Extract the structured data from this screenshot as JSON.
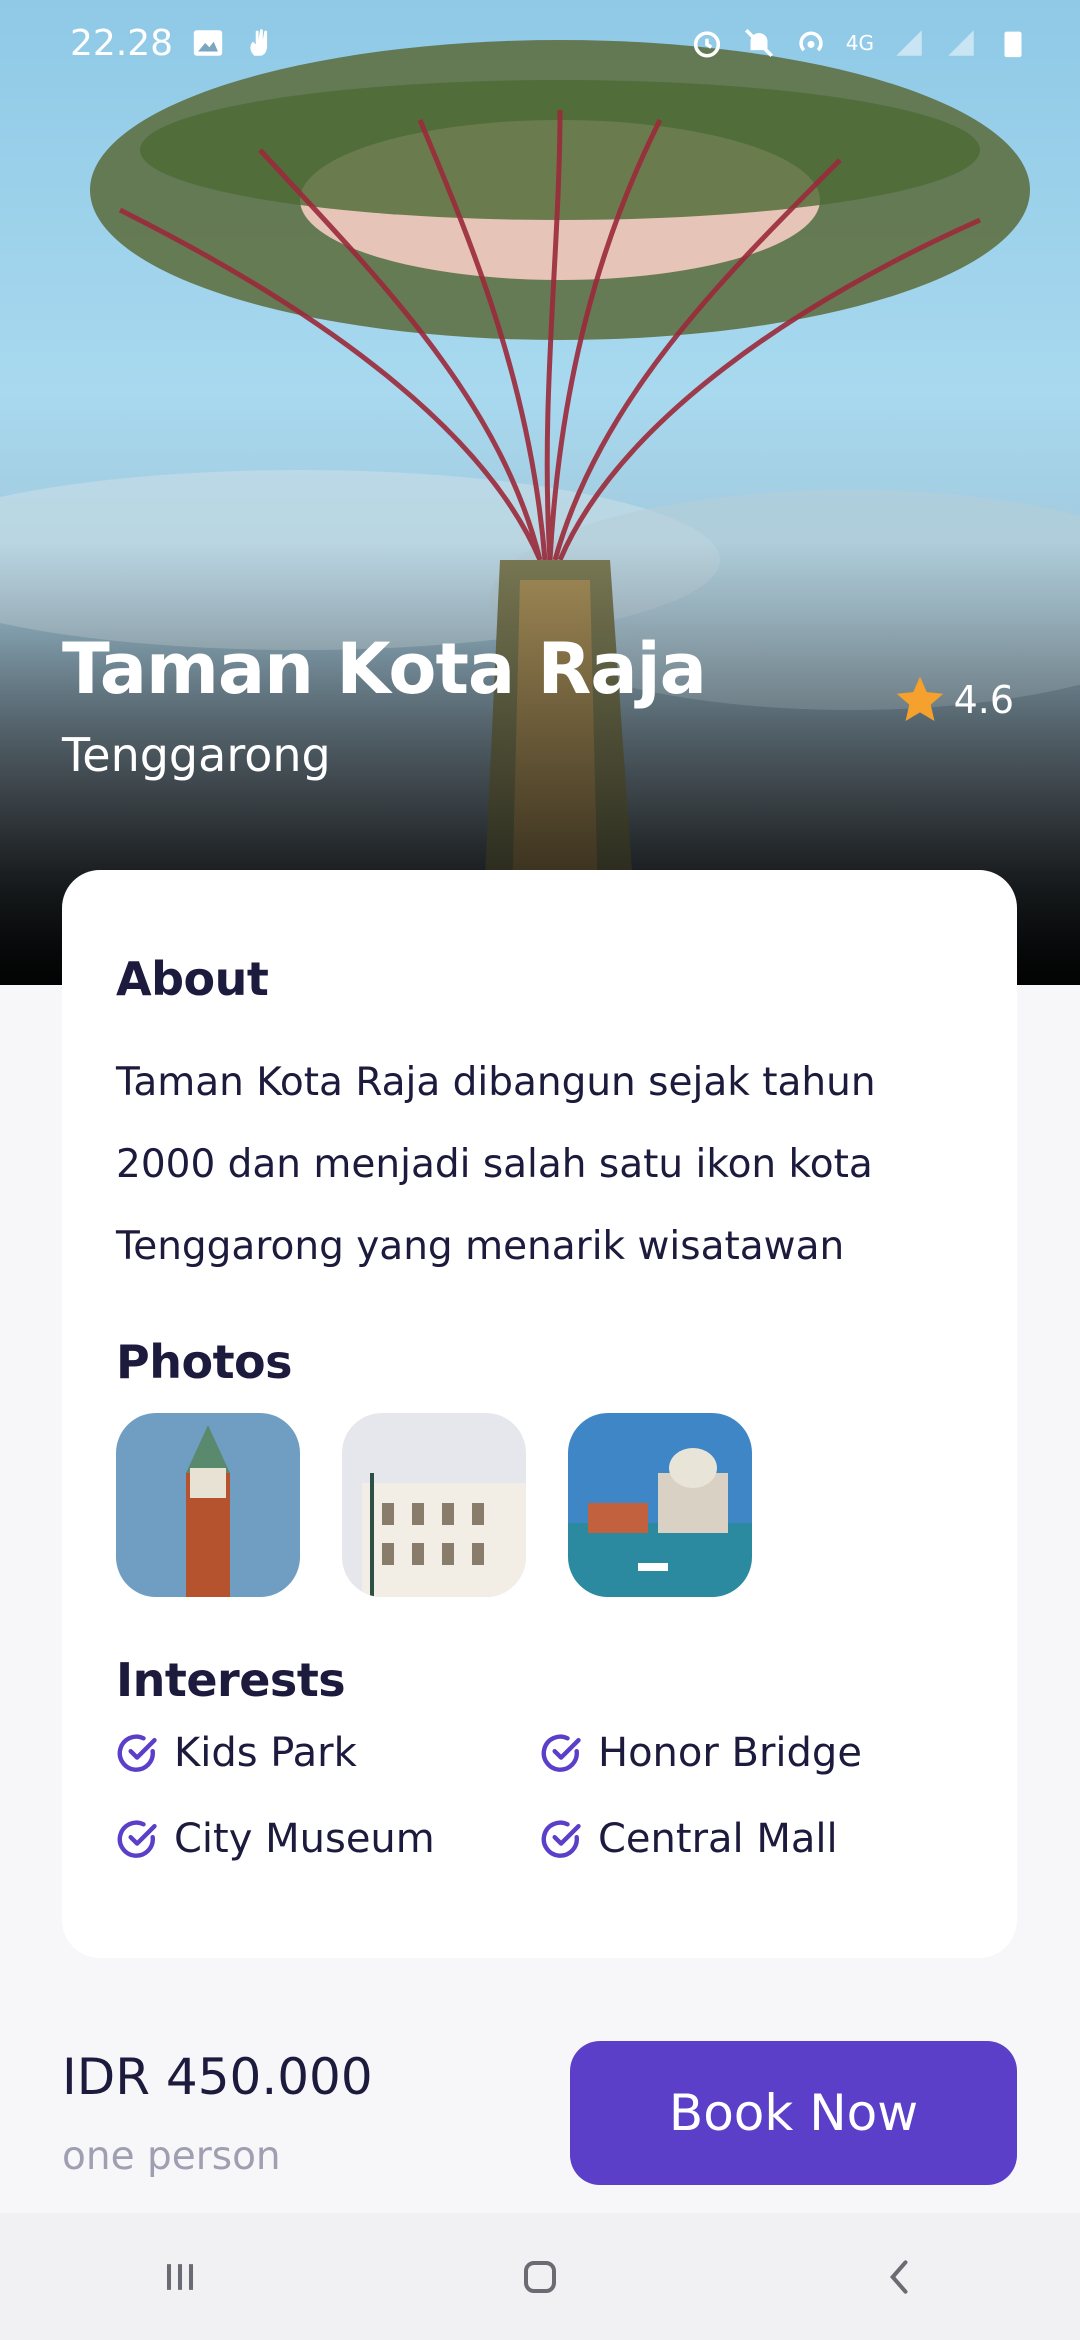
{
  "status_bar": {
    "time": "22.28",
    "network": "4G",
    "icons_left": [
      "image-icon",
      "hand-icon"
    ],
    "icons_right": [
      "alarm-icon",
      "mute-icon",
      "hotspot-icon",
      "signal-icon",
      "signal-icon",
      "battery-icon"
    ]
  },
  "place": {
    "name": "Taman Kota Raja",
    "city": "Tenggarong",
    "rating": "4.6"
  },
  "about": {
    "heading": "About",
    "text": "Taman Kota Raja dibangun sejak tahun 2000 dan menjadi salah satu ikon kota Tenggarong yang menarik wisatawan"
  },
  "photos": {
    "heading": "Photos",
    "items": [
      "bell-tower-photo",
      "venetian-building-photo",
      "grand-canal-photo"
    ]
  },
  "interests": {
    "heading": "Interests",
    "items": [
      "Kids Park",
      "Honor Bridge",
      "City Museum",
      "Central Mall"
    ]
  },
  "booking": {
    "price": "IDR 450.000",
    "per": "one person",
    "button_label": "Book Now"
  },
  "colors": {
    "accent": "#5b3fc8",
    "text_dark": "#1c1a3d",
    "text_muted": "#a09fb1",
    "star": "#f6a02d"
  },
  "nav": [
    "recent-apps-icon",
    "home-icon",
    "back-icon"
  ]
}
